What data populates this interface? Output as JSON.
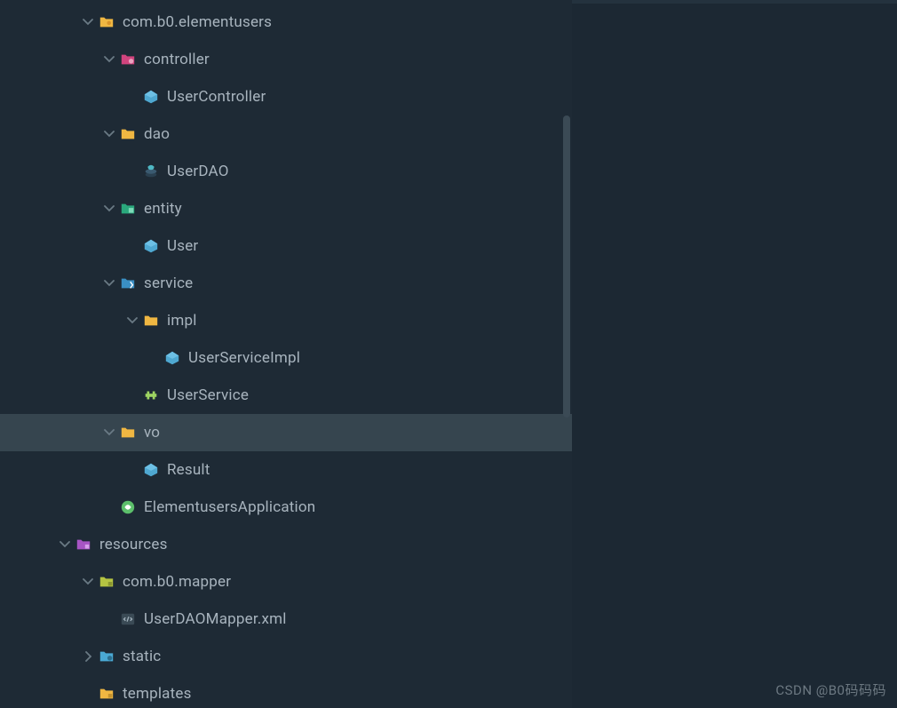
{
  "watermark": "CSDN @B0码码码",
  "tree": [
    {
      "indent": 1,
      "chevron": "down",
      "icon": "folder-package",
      "name": "com.b0.elementusers",
      "selected": false
    },
    {
      "indent": 2,
      "chevron": "down",
      "icon": "folder-controller",
      "name": "controller",
      "selected": false
    },
    {
      "indent": 3,
      "chevron": "none",
      "icon": "class",
      "name": "UserController",
      "selected": false
    },
    {
      "indent": 2,
      "chevron": "down",
      "icon": "folder",
      "name": "dao",
      "selected": false
    },
    {
      "indent": 3,
      "chevron": "none",
      "icon": "dao",
      "name": "UserDAO",
      "selected": false
    },
    {
      "indent": 2,
      "chevron": "down",
      "icon": "folder-entity",
      "name": "entity",
      "selected": false
    },
    {
      "indent": 3,
      "chevron": "none",
      "icon": "class",
      "name": "User",
      "selected": false
    },
    {
      "indent": 2,
      "chevron": "down",
      "icon": "folder-service",
      "name": "service",
      "selected": false
    },
    {
      "indent": 3,
      "chevron": "down",
      "icon": "folder",
      "name": "impl",
      "selected": false
    },
    {
      "indent": 4,
      "chevron": "none",
      "icon": "class",
      "name": "UserServiceImpl",
      "selected": false
    },
    {
      "indent": 3,
      "chevron": "none",
      "icon": "interface",
      "name": "UserService",
      "selected": false
    },
    {
      "indent": 2,
      "chevron": "down",
      "icon": "folder",
      "name": "vo",
      "selected": true
    },
    {
      "indent": 3,
      "chevron": "none",
      "icon": "class",
      "name": "Result",
      "selected": false
    },
    {
      "indent": 2,
      "chevron": "none",
      "icon": "spring",
      "name": "ElementusersApplication",
      "selected": false
    },
    {
      "indent": 0,
      "chevron": "down",
      "icon": "folder-resources",
      "name": "resources",
      "selected": false
    },
    {
      "indent": 1,
      "chevron": "down",
      "icon": "folder-mapper",
      "name": "com.b0.mapper",
      "selected": false
    },
    {
      "indent": 2,
      "chevron": "none",
      "icon": "xml",
      "name": "UserDAOMapper.xml",
      "selected": false
    },
    {
      "indent": 1,
      "chevron": "right",
      "icon": "folder-static",
      "name": "static",
      "selected": false
    },
    {
      "indent": 1,
      "chevron": "none",
      "icon": "folder-templates",
      "name": "templates",
      "selected": false
    }
  ]
}
